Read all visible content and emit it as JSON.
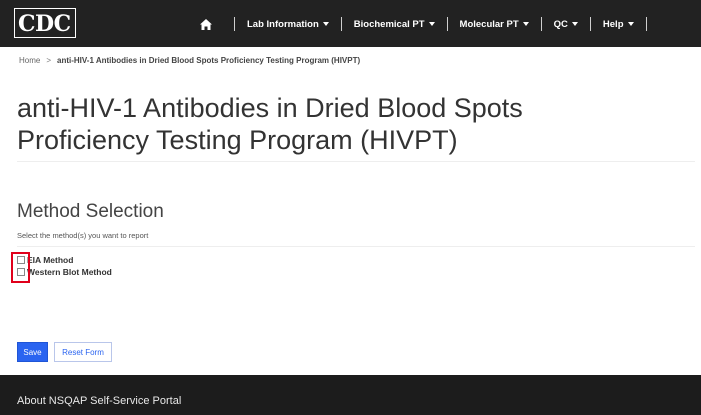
{
  "header": {
    "logo_text": "CDC",
    "nav": [
      {
        "label": "Lab Information",
        "dropdown": true
      },
      {
        "label": "Biochemical PT",
        "dropdown": true
      },
      {
        "label": "Molecular PT",
        "dropdown": true
      },
      {
        "label": "QC",
        "dropdown": true
      },
      {
        "label": "Help",
        "dropdown": true
      }
    ],
    "home_icon": "home-icon"
  },
  "breadcrumb": {
    "home": "Home",
    "separator": ">",
    "current": "anti-HIV-1 Antibodies in Dried Blood Spots Proficiency Testing Program (HIVPT)"
  },
  "page": {
    "title": "anti-HIV-1 Antibodies in Dried Blood Spots Proficiency Testing Program (HIVPT)"
  },
  "method_section": {
    "title": "Method Selection",
    "instruction": "Select the method(s) you want to report",
    "methods": [
      {
        "label": "EIA Method",
        "checked": false
      },
      {
        "label": "Western Blot Method",
        "checked": false
      }
    ]
  },
  "actions": {
    "save_label": "Save",
    "reset_label": "Reset Form"
  },
  "footer": {
    "text": "About NSQAP Self-Service Portal"
  },
  "colors": {
    "topbar": "#222222",
    "primary": "#2a64f0",
    "highlight": "#e0001b",
    "footer": "#1c1c1c"
  }
}
